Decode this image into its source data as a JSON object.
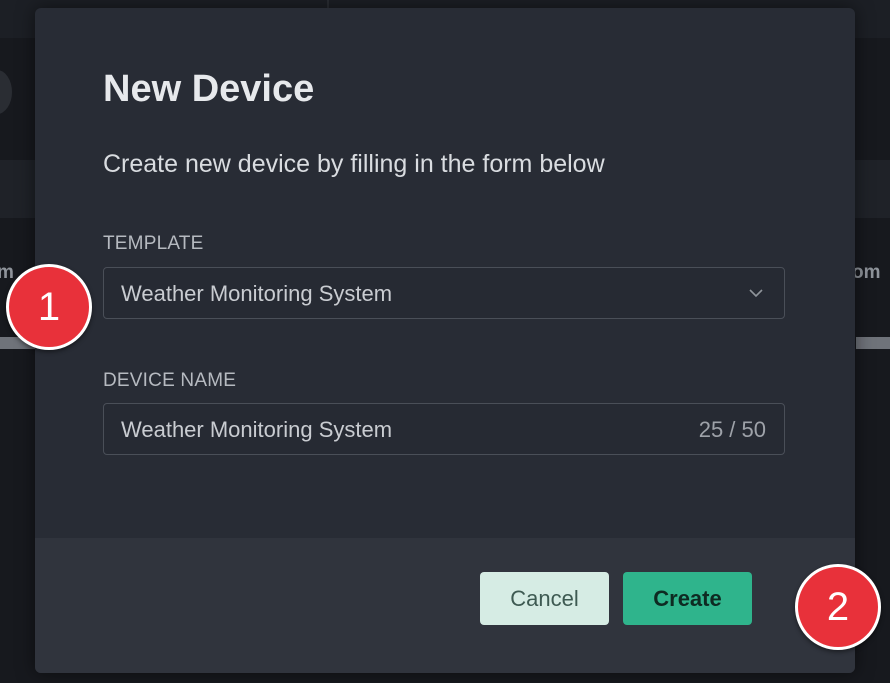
{
  "background": {
    "left_fragment": "m",
    "right_fragment": "om"
  },
  "modal": {
    "title": "New Device",
    "subtitle": "Create new device by filling in the form below",
    "template": {
      "label": "TEMPLATE",
      "value": "Weather Monitoring System",
      "icon": "chevron-down-icon"
    },
    "device_name": {
      "label": "DEVICE NAME",
      "value": "Weather Monitoring System",
      "counter": "25 / 50"
    },
    "cancel_label": "Cancel",
    "create_label": "Create"
  },
  "annotations": {
    "step_1": "1",
    "step_2": "2"
  },
  "colors": {
    "modal_bg": "#282c35",
    "footer_bg": "#30343d",
    "accent": "#2fb48c",
    "cancel_bg": "#d6ece4",
    "badge": "#e8313a"
  }
}
